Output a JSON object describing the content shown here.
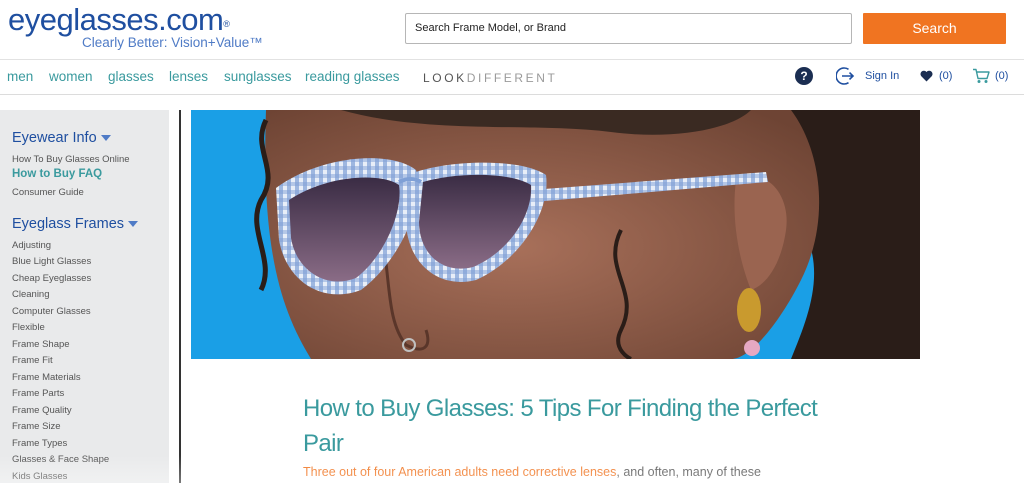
{
  "header": {
    "logo_text": "eyeglasses.com",
    "logo_reg": "®",
    "tagline": "Clearly Better: Vision+Value™",
    "search_placeholder": "Search Frame Model, or Brand",
    "search_button": "Search"
  },
  "nav": {
    "items": [
      "men",
      "women",
      "glasses",
      "lenses",
      "sunglasses",
      "reading glasses"
    ],
    "look": "LOOK",
    "different": "DIFFERENT",
    "sign_in": "Sign In",
    "wishlist_count": "(0)",
    "cart_count": "(0)"
  },
  "sidebar": {
    "section1": {
      "heading": "Eyewear Info",
      "links": [
        "How To Buy Glasses Online",
        "How to Buy FAQ",
        "Consumer Guide"
      ]
    },
    "section2": {
      "heading": "Eyeglass Frames",
      "links": [
        "Adjusting",
        "Blue Light Glasses",
        "Cheap Eyeglasses",
        "Cleaning",
        "Computer Glasses",
        "Flexible",
        "Frame Shape",
        "Frame Fit",
        "Frame Materials",
        "Frame Parts",
        "Frame Quality",
        "Frame Size",
        "Frame Types",
        "Glasses & Face Shape",
        "Kids Glasses"
      ]
    }
  },
  "article": {
    "title": "How to Buy Glasses: 5 Tips For Finding the Perfect Pair",
    "intro_link": "Three out of four American adults need corrective lenses",
    "intro_rest": ", and often, many of these"
  },
  "colors": {
    "brand_blue": "#1f4fa0",
    "teal": "#3a9a9e",
    "orange": "#f07421",
    "hero_bg": "#1a9fe6"
  }
}
